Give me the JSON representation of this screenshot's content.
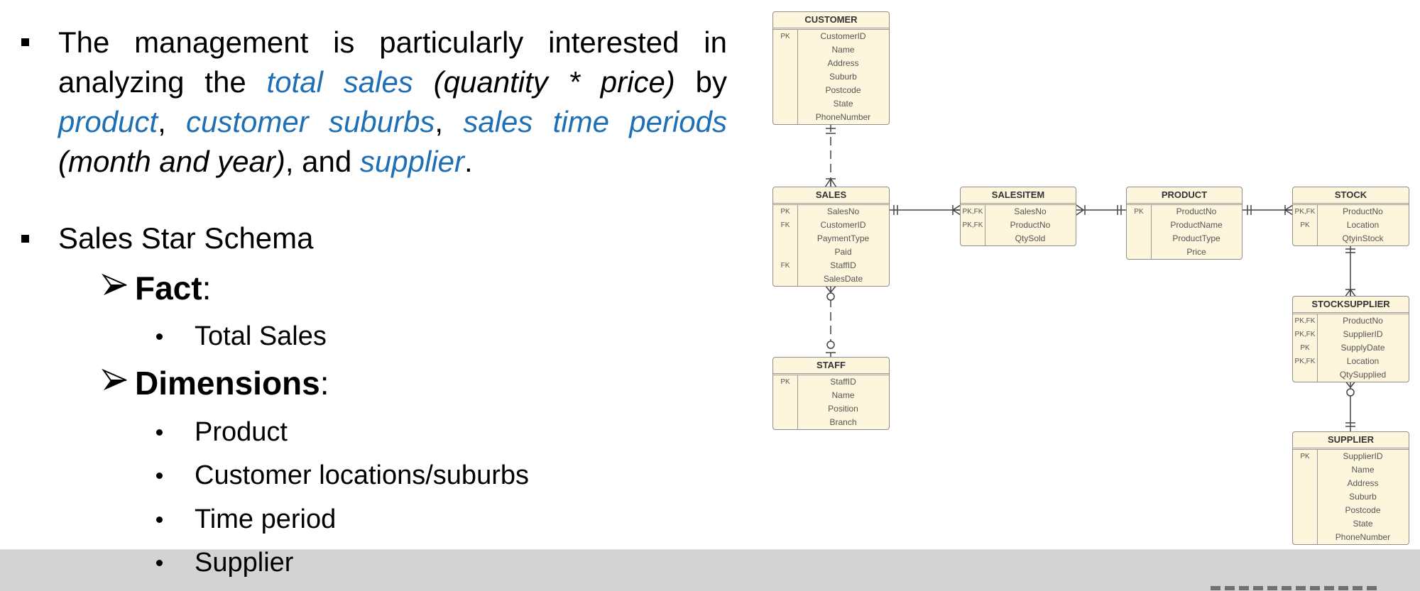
{
  "slide": {
    "intro_paragraph": {
      "segments": [
        {
          "text": "The management is particularly interested in analyzing the ",
          "style": "normal"
        },
        {
          "text": "total sales",
          "style": "highlight"
        },
        {
          "text": " (quantity * price)",
          "style": "italic"
        },
        {
          "text": " by ",
          "style": "normal"
        },
        {
          "text": "product",
          "style": "highlight"
        },
        {
          "text": ", ",
          "style": "normal"
        },
        {
          "text": "customer suburbs",
          "style": "highlight"
        },
        {
          "text": ", ",
          "style": "normal"
        },
        {
          "text": "sales time periods",
          "style": "highlight"
        },
        {
          "text": " (month and year)",
          "style": "italic"
        },
        {
          "text": ", and ",
          "style": "normal"
        },
        {
          "text": "supplier",
          "style": "highlight"
        },
        {
          "text": ".",
          "style": "normal"
        }
      ]
    },
    "schema_heading": "Sales Star Schema",
    "fact": {
      "label": "Fact",
      "colon": ":",
      "items": [
        "Total Sales"
      ]
    },
    "dimensions": {
      "label": "Dimensions",
      "colon": ":",
      "items": [
        "Product",
        "Customer locations/suburbs",
        "Time period",
        "Supplier"
      ]
    },
    "colors": {
      "highlight": "#1f6fb5",
      "entity_fill": "#fdf5dc",
      "entity_border": "#8e8e8e",
      "footer_band": "#d3d3d3"
    }
  },
  "erd": {
    "entities": {
      "customer": {
        "name": "CUSTOMER",
        "rows": [
          {
            "key": "PK",
            "field": "CustomerID"
          },
          {
            "key": "",
            "field": "Name"
          },
          {
            "key": "",
            "field": "Address"
          },
          {
            "key": "",
            "field": "Suburb"
          },
          {
            "key": "",
            "field": "Postcode"
          },
          {
            "key": "",
            "field": "State"
          },
          {
            "key": "",
            "field": "PhoneNumber"
          }
        ]
      },
      "sales": {
        "name": "SALES",
        "rows": [
          {
            "key": "PK",
            "field": "SalesNo"
          },
          {
            "key": "FK",
            "field": "CustomerID"
          },
          {
            "key": "",
            "field": "PaymentType"
          },
          {
            "key": "",
            "field": "Paid"
          },
          {
            "key": "FK",
            "field": "StaffID"
          },
          {
            "key": "",
            "field": "SalesDate"
          }
        ]
      },
      "staff": {
        "name": "STAFF",
        "rows": [
          {
            "key": "PK",
            "field": "StaffID"
          },
          {
            "key": "",
            "field": "Name"
          },
          {
            "key": "",
            "field": "Position"
          },
          {
            "key": "",
            "field": "Branch"
          }
        ]
      },
      "salesitem": {
        "name": "SALESITEM",
        "rows": [
          {
            "key": "PK,FK",
            "field": "SalesNo"
          },
          {
            "key": "PK,FK",
            "field": "ProductNo"
          },
          {
            "key": "",
            "field": "QtySold"
          }
        ]
      },
      "product": {
        "name": "PRODUCT",
        "rows": [
          {
            "key": "PK",
            "field": "ProductNo"
          },
          {
            "key": "",
            "field": "ProductName"
          },
          {
            "key": "",
            "field": "ProductType"
          },
          {
            "key": "",
            "field": "Price"
          }
        ]
      },
      "stock": {
        "name": "STOCK",
        "rows": [
          {
            "key": "PK,FK",
            "field": "ProductNo"
          },
          {
            "key": "PK",
            "field": "Location"
          },
          {
            "key": "",
            "field": "QtyinStock"
          }
        ]
      },
      "stocksupplier": {
        "name": "STOCKSUPPLIER",
        "rows": [
          {
            "key": "PK,FK",
            "field": "ProductNo"
          },
          {
            "key": "PK,FK",
            "field": "SupplierID"
          },
          {
            "key": "PK",
            "field": "SupplyDate"
          },
          {
            "key": "PK,FK",
            "field": "Location"
          },
          {
            "key": "",
            "field": "QtySupplied"
          }
        ]
      },
      "supplier": {
        "name": "SUPPLIER",
        "rows": [
          {
            "key": "PK",
            "field": "SupplierID"
          },
          {
            "key": "",
            "field": "Name"
          },
          {
            "key": "",
            "field": "Address"
          },
          {
            "key": "",
            "field": "Suburb"
          },
          {
            "key": "",
            "field": "Postcode"
          },
          {
            "key": "",
            "field": "State"
          },
          {
            "key": "",
            "field": "PhoneNumber"
          }
        ]
      }
    },
    "relationships": [
      {
        "from": "customer",
        "to": "sales",
        "from_cardinality": "one-and-only-one",
        "to_cardinality": "one-or-many",
        "line": "dashed"
      },
      {
        "from": "sales",
        "to": "staff",
        "from_cardinality": "zero-or-many",
        "to_cardinality": "zero-or-one",
        "line": "dashed"
      },
      {
        "from": "sales",
        "to": "salesitem",
        "from_cardinality": "one-and-only-one",
        "to_cardinality": "one-or-many",
        "line": "solid"
      },
      {
        "from": "salesitem",
        "to": "product",
        "from_cardinality": "one-or-many",
        "to_cardinality": "one-and-only-one",
        "line": "solid"
      },
      {
        "from": "product",
        "to": "stock",
        "from_cardinality": "one-and-only-one",
        "to_cardinality": "one-or-many",
        "line": "solid"
      },
      {
        "from": "stock",
        "to": "stocksupplier",
        "from_cardinality": "one-and-only-one",
        "to_cardinality": "one-or-many",
        "line": "solid"
      },
      {
        "from": "stocksupplier",
        "to": "supplier",
        "from_cardinality": "zero-or-many",
        "to_cardinality": "one-and-only-one",
        "line": "solid"
      }
    ]
  }
}
